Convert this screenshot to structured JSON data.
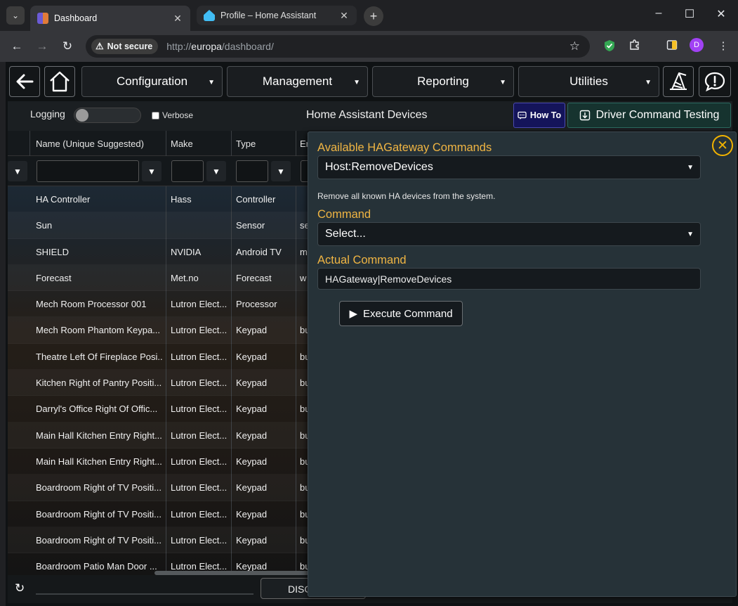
{
  "browser": {
    "tabs": [
      {
        "title": "Dashboard",
        "close": "✕",
        "favicon_color": "#6b5bd6"
      },
      {
        "title": "Profile – Home Assistant",
        "close": "✕",
        "favicon_color": "#41bdf5"
      }
    ],
    "tab_menu_icon": "⌄",
    "new_tab": "+",
    "window": {
      "minimize": "–",
      "maximize": "☐",
      "close": "✕"
    },
    "nav": {
      "back": "←",
      "forward": "→",
      "reload": "↻"
    },
    "security_label": "Not secure",
    "url_prefix": "http://",
    "url_host": "europa",
    "url_path": "/dashboard/",
    "profile_initial": "D",
    "accent_colors": {
      "profile": "#a142f4",
      "shield_ext": "#34a853"
    }
  },
  "nav": {
    "menus": [
      {
        "label": "Configuration"
      },
      {
        "label": "Management"
      },
      {
        "label": "Reporting"
      },
      {
        "label": "Utilities"
      }
    ],
    "icons": [
      "back-arrow-icon",
      "home-icon",
      "wizard-hat-icon",
      "alert-bubble-icon"
    ]
  },
  "subbar": {
    "logging_label": "Logging",
    "verbose_label": "Verbose",
    "title": "Home Assistant Devices",
    "howto_label": "How To",
    "driver_testing_label": "Driver Command Testing"
  },
  "grid": {
    "columns": [
      "Name (Unique Suggested)",
      "Make",
      "Type",
      "En"
    ],
    "rows": [
      [
        "HA Controller",
        "Hass",
        "Controller",
        ""
      ],
      [
        "Sun",
        "",
        "Sensor",
        "se"
      ],
      [
        "SHIELD",
        "NVIDIA",
        "Android TV",
        "m"
      ],
      [
        "Forecast",
        "Met.no",
        "Forecast",
        "w"
      ],
      [
        "Mech Room Processor 001",
        "Lutron Elect...",
        "Processor",
        ""
      ],
      [
        "Mech Room Phantom Keypa...",
        "Lutron Elect...",
        "Keypad",
        "bu"
      ],
      [
        "Theatre Left Of Fireplace Posi...",
        "Lutron Elect...",
        "Keypad",
        "bu"
      ],
      [
        "Kitchen Right of Pantry Positi...",
        "Lutron Elect...",
        "Keypad",
        "bu"
      ],
      [
        "Darryl's Office Right Of Offic...",
        "Lutron Elect...",
        "Keypad",
        "bu"
      ],
      [
        "Main Hall Kitchen Entry Right...",
        "Lutron Elect...",
        "Keypad",
        "bu"
      ],
      [
        "Main Hall Kitchen Entry Right...",
        "Lutron Elect...",
        "Keypad",
        "bu"
      ],
      [
        "Boardroom Right of TV Positi...",
        "Lutron Elect...",
        "Keypad",
        "bu"
      ],
      [
        "Boardroom Right of TV Positi...",
        "Lutron Elect...",
        "Keypad",
        "bu"
      ],
      [
        "Boardroom Right of TV Positi...",
        "Lutron Elect...",
        "Keypad",
        "bu"
      ],
      [
        "Boardroom Patio Man Door ...",
        "Lutron Elect...",
        "Keypad",
        "bu"
      ]
    ]
  },
  "bottom": {
    "refresh_icon": "↻",
    "disc_label": "DISC"
  },
  "panel": {
    "gateway_label": "Available HAGateway Commands",
    "gateway_value": "Host:RemoveDevices",
    "description": "Remove all known HA devices from the system.",
    "command_label": "Command",
    "command_value": "Select...",
    "actual_label": "Actual Command",
    "actual_value": "HAGateway|RemoveDevices",
    "execute_label": "Execute Command",
    "accent_color": "#f0b543"
  }
}
